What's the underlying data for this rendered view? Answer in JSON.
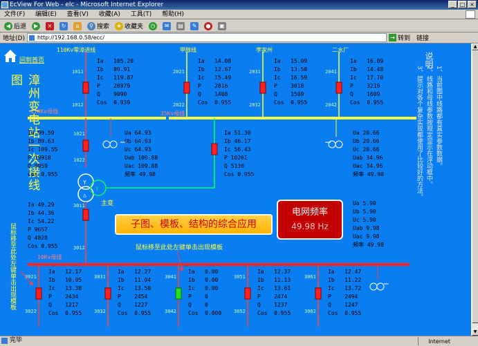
{
  "window": {
    "title": "EcView For Web - elc - Microsoft Internet Explorer",
    "buttons": [
      "_",
      "□",
      "×"
    ]
  },
  "menu": [
    "文件(F)",
    "编辑(E)",
    "查看(V)",
    "收藏(A)",
    "工具(T)",
    "帮助(H)"
  ],
  "toolbar": {
    "back": "后退",
    "search": "搜索",
    "favorites": "收藏夹"
  },
  "address": {
    "label": "地址(D)",
    "url": "http://192.168.0.58/ecc/",
    "go": "转到",
    "links": "链接"
  },
  "status": {
    "text": "完毕",
    "zone": "Internet"
  },
  "scada": {
    "home_link": "回到首页",
    "side_title": "漳州变电站一次接线图",
    "left_note": "鼠标移至此处左键单击出现模板",
    "hover_note": "鼠标移至此处左键单击出现模板",
    "help_title": "说明",
    "help_lines": [
      "1、当前图中线路都有真实参数数据。",
      "2、线路和母线参数按规定显示在浮动框中。",
      "3、提示对各个复杂实现都使用了比较好的方法。"
    ],
    "bus_110": "110Kv母线",
    "bus_35": "35Kv母线",
    "bus_10": "10Kv母线",
    "main_transformer": "主变",
    "banner": "子图、模板、结构的综合应用",
    "freq_title": "电网频率",
    "freq_value": "49.98 Hz",
    "lines_top": [
      {
        "name": "110Kv零漳进线",
        "id1": "1011",
        "id2": "1012",
        "Ia": "105.20",
        "Ib": "89.91",
        "Ic": "119.87",
        "P": "20979",
        "Q": "9090",
        "Cos": "0.939"
      },
      {
        "name": "甲醇线",
        "id1": "2021",
        "id2": "2022",
        "Ia": "14.08",
        "Ib": "12.67",
        "Ic": "15.49",
        "P": "2816",
        "Q": "1408",
        "Cos": "0.955"
      },
      {
        "name": "李家州",
        "id1": "2031",
        "id2": "2032",
        "Ia": "15.09",
        "Ib": "13.58",
        "Ic": "16.59",
        "P": "3018",
        "Q": "1509",
        "Cos": "0.955"
      },
      {
        "name": "二水厂",
        "id1": "2041",
        "id2": "2042",
        "Ia": "16.09",
        "Ib": "14.48",
        "Ic": "17.70",
        "P": "3219",
        "Q": "1609",
        "Cos": "0.955"
      }
    ],
    "bus110_meas": [
      "Ia 99.59",
      "Ib 89.63",
      "Ic 109.55",
      "P 19918",
      "Q 9959",
      "Cos 0.955"
    ],
    "bus110_volt": [
      "Ua 64.93",
      "Ub 64.93",
      "Uc 64.93",
      "Uab 109.88",
      "Uac 109.88",
      "频率 49.98"
    ],
    "tx_meas": [
      "Ia 51.30",
      "Ib 46.17",
      "Ic 56.43",
      "P 10261",
      "Q 5130",
      "Cos 0.955"
    ],
    "bus35_volt": [
      "Ua 20.66",
      "Ub 20.66",
      "Uc 20.66",
      "Uab 34.96",
      "Uac 34.96",
      "频率 49.98"
    ],
    "low_meas": [
      "Ia 49.29",
      "Ib 44.36",
      "Ic 54.22",
      "P 9657",
      "Q 4828",
      "Cos 0.955"
    ],
    "bus10_volt": [
      "Ua 5.90",
      "Ub 5.90",
      "Uc 5.90",
      "Uab 9.98",
      "Uac 9.98",
      "频率 49.98"
    ],
    "lines_bottom": [
      {
        "id1": "3021",
        "id2": "3022",
        "Ia": "12.17",
        "Ib": "10.95",
        "Ic": "13.38",
        "P": "2434",
        "Q": "1217",
        "Cos": "0.955",
        "on": true
      },
      {
        "id1": "3031",
        "id2": "3032",
        "Ia": "12.27",
        "Ib": "11.04",
        "Ic": "13.50",
        "P": "2454",
        "Q": "1227",
        "Cos": "0.955",
        "on": true
      },
      {
        "id1": "3041",
        "id2": "3042",
        "Ia": "0.00",
        "Ib": "0.00",
        "Ic": "0.00",
        "P": "0",
        "Q": "0",
        "Cos": "0.000",
        "on": false
      },
      {
        "id1": "3051",
        "id2": "3052",
        "Ia": "12.37",
        "Ib": "11.13",
        "Ic": "13.61",
        "P": "2474",
        "Q": "1237",
        "Cos": "0.955",
        "on": true
      },
      {
        "id1": "3061",
        "id2": "3062",
        "Ia": "12.47",
        "Ib": "11.22",
        "Ic": "13.72",
        "P": "2494",
        "Q": "1247",
        "Cos": "0.955",
        "on": true
      }
    ],
    "bus_colors": {
      "bus110": "#ffff40",
      "bus35": "#ffff40",
      "bus10": "#ff2020"
    }
  }
}
